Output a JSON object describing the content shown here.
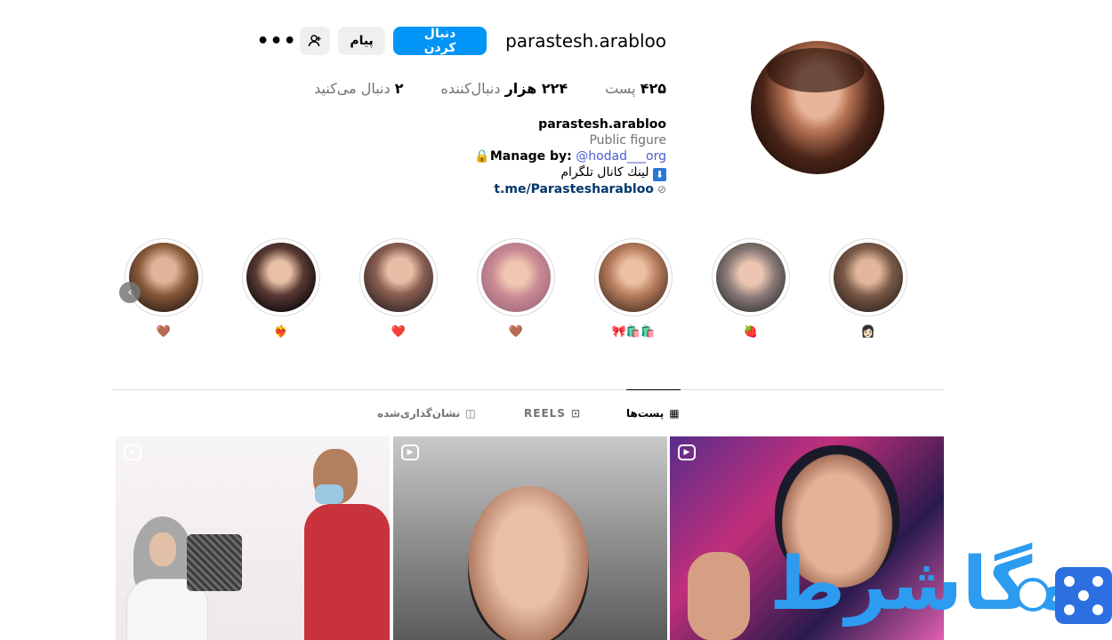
{
  "profile": {
    "username": "parastesh.arabloo",
    "follow_label": "دنبال کردن",
    "message_label": "پیام",
    "more_label": "•••",
    "stats": {
      "posts": {
        "count": "۴۲۵",
        "label": "پست"
      },
      "followers": {
        "count": "۲۲۴ هزار",
        "label": "دنبال‌کننده"
      },
      "following": {
        "count": "۲",
        "label": "دنبال می‌کنید"
      }
    },
    "bio": {
      "name": "parastesh.arabloo",
      "category": "Public figure",
      "manage_label": "Manage by:",
      "manage_emoji": "🔒",
      "manage_handle": "@hodad___org",
      "telegram_text": "لینك كانال تلگرام",
      "telegram_arrow": "⬇",
      "link": "t.me/Parastesharabloo",
      "link_icon": "🔗"
    }
  },
  "highlights": [
    {
      "label": "🤎",
      "avatar_color": "#8a5a3a"
    },
    {
      "label": "❤️‍🔥",
      "avatar_color": "#2a1a1e"
    },
    {
      "label": "❤️",
      "avatar_color": "#6e4636"
    },
    {
      "label": "🤎",
      "avatar_color": "#d49a9e"
    },
    {
      "label": "🎀🛍️🛍️",
      "avatar_color": "#c88a6a"
    },
    {
      "label": "🍓",
      "avatar_color": "#8a6c64"
    },
    {
      "label": "👩🏻",
      "avatar_color": "#6a5040"
    }
  ],
  "highlights_prev_icon": "‹",
  "tabs": [
    {
      "label": "پست‌ها",
      "icon": "▦"
    },
    {
      "label": "REELS",
      "icon": "⊡"
    },
    {
      "label": "نشان‌گذاری‌شده",
      "icon": "◫"
    }
  ],
  "posts": [
    {
      "type": "reel",
      "reel_icon": "▶"
    },
    {
      "type": "reel",
      "reel_icon": "▶"
    },
    {
      "type": "reel",
      "reel_icon": "▶"
    }
  ],
  "watermark": {
    "text": "مگاشرط"
  },
  "colors": {
    "accent": "#0095f6",
    "link": "#00376b",
    "mention": "#4a5cd1",
    "muted": "#737373",
    "watermark": "#2d9bf0"
  }
}
